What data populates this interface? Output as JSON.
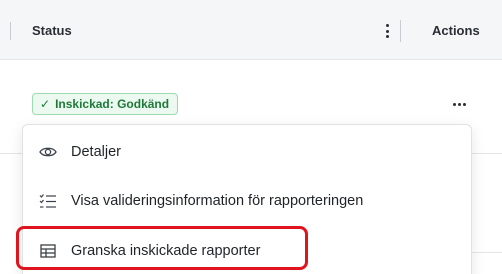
{
  "table": {
    "columns": {
      "status": "Status",
      "actions": "Actions"
    },
    "row": {
      "status_badge": "Inskickad: Godkänd",
      "status_color": "#1f7a3a"
    }
  },
  "menu": {
    "items": [
      {
        "label": "Detaljer",
        "icon": "eye-icon"
      },
      {
        "label": "Visa valideringsinformation för rapporteringen",
        "icon": "checklist-icon"
      },
      {
        "label": "Granska inskickade rapporter",
        "icon": "table-icon",
        "highlighted": true
      }
    ],
    "highlight_color": "#e0141e"
  }
}
